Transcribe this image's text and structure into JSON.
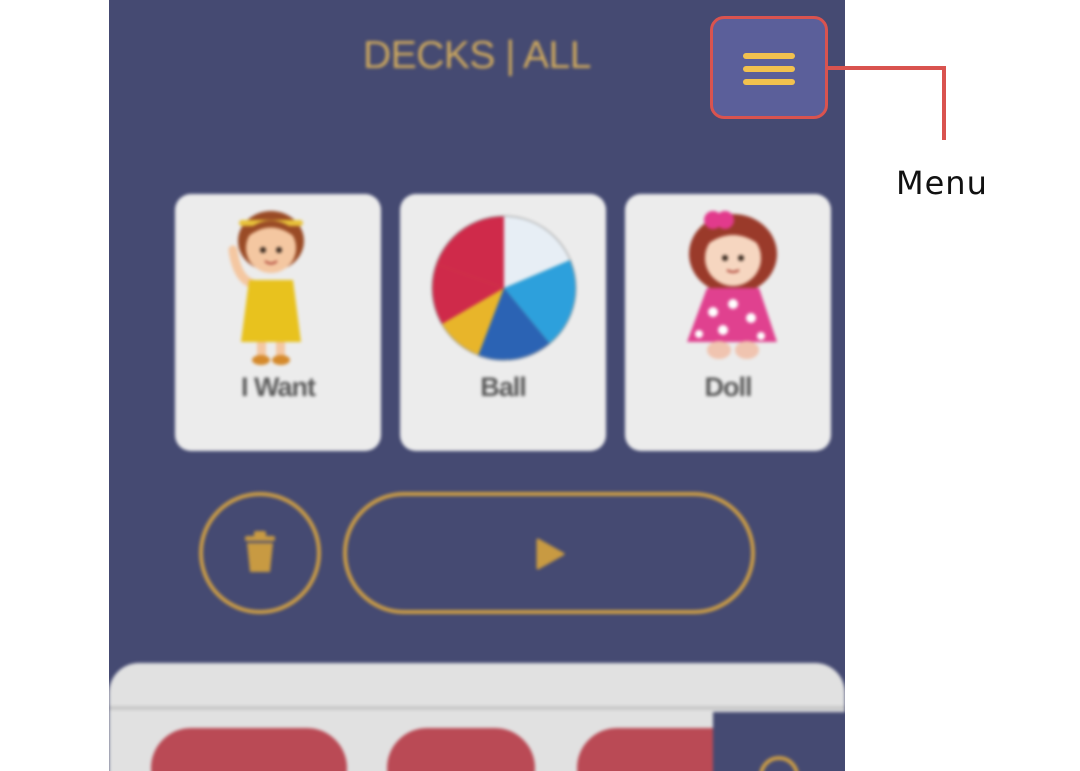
{
  "header": {
    "title": "DECKS | ALL"
  },
  "cards": [
    {
      "label": "I Want",
      "image": "girl-waving-icon"
    },
    {
      "label": "Ball",
      "image": "beach-ball-icon"
    },
    {
      "label": "Doll",
      "image": "doll-icon"
    }
  ],
  "controls": {
    "delete_icon": "trash-icon",
    "play_icon": "play-icon"
  },
  "menu": {
    "icon": "hamburger-icon"
  },
  "annotation": {
    "label": "Menu"
  },
  "colors": {
    "background": "#454a72",
    "accent": "#cc9d45",
    "callout": "#d9534f",
    "menu_bg": "#5b5f9a",
    "menu_lines": "#f2c14e"
  }
}
